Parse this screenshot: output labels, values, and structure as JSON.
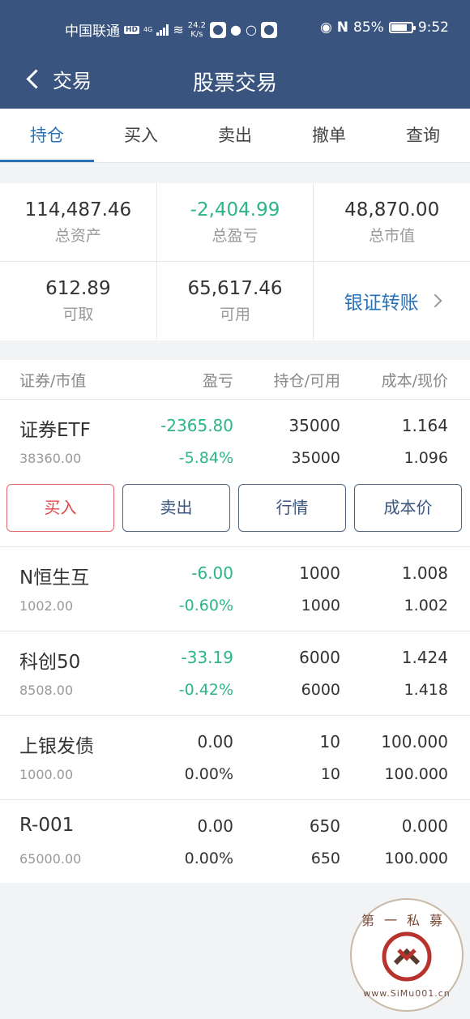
{
  "status_bar": {
    "carrier": "中国联通",
    "hd": "HD",
    "network": "4G",
    "speed_value": "24.2",
    "speed_unit": "K/s",
    "battery_percent": "85%",
    "battery_level": 0.85,
    "time": "9:52",
    "icons": [
      "signal-icon",
      "wifi-icon",
      "app-icon",
      "qq-icon",
      "qq-outline-icon",
      "app-icon",
      "eye-icon",
      "nfc-icon",
      "battery-icon"
    ]
  },
  "navbar": {
    "back_label": "交易",
    "title": "股票交易"
  },
  "tabs": [
    {
      "label": "持仓",
      "active": true
    },
    {
      "label": "买入",
      "active": false
    },
    {
      "label": "卖出",
      "active": false
    },
    {
      "label": "撤单",
      "active": false
    },
    {
      "label": "查询",
      "active": false
    }
  ],
  "summary": {
    "total_assets": {
      "value": "114,487.46",
      "label": "总资产"
    },
    "total_pnl": {
      "value": "-2,404.99",
      "label": "总盈亏"
    },
    "market_value": {
      "value": "48,870.00",
      "label": "总市值"
    },
    "withdrawable": {
      "value": "612.89",
      "label": "可取"
    },
    "available": {
      "value": "65,617.46",
      "label": "可用"
    },
    "transfer_label": "银证转账"
  },
  "positions": {
    "headers": {
      "security": "证券/市值",
      "pnl": "盈亏",
      "holding": "持仓/可用",
      "cost": "成本/现价"
    },
    "rows": [
      {
        "name": "证券ETF",
        "market_value": "38360.00",
        "pnl": "-2365.80",
        "pnl_pct": "-5.84%",
        "holding": "35000",
        "available": "35000",
        "cost": "1.164",
        "price": "1.096"
      },
      {
        "name": "N恒生互",
        "market_value": "1002.00",
        "pnl": "-6.00",
        "pnl_pct": "-0.60%",
        "holding": "1000",
        "available": "1000",
        "cost": "1.008",
        "price": "1.002"
      },
      {
        "name": "科创50",
        "market_value": "8508.00",
        "pnl": "-33.19",
        "pnl_pct": "-0.42%",
        "holding": "6000",
        "available": "6000",
        "cost": "1.424",
        "price": "1.418"
      },
      {
        "name": "上银发债",
        "market_value": "1000.00",
        "pnl": "0.00",
        "pnl_pct": "0.00%",
        "holding": "10",
        "available": "10",
        "cost": "100.000",
        "price": "100.000"
      },
      {
        "name": "R-001",
        "market_value": "65000.00",
        "pnl": "0.00",
        "pnl_pct": "0.00%",
        "holding": "650",
        "available": "650",
        "cost": "0.000",
        "price": "100.000"
      }
    ],
    "actions": {
      "buy": "买入",
      "sell": "卖出",
      "quote": "行情",
      "cost_price": "成本价"
    }
  },
  "watermark": {
    "top_text": "第一私募",
    "url": "www.SiMu001.cn"
  },
  "colors": {
    "header": "#3a5480",
    "accent": "#2a72b8",
    "loss": "#2bb58a",
    "buy": "#e0494b"
  }
}
